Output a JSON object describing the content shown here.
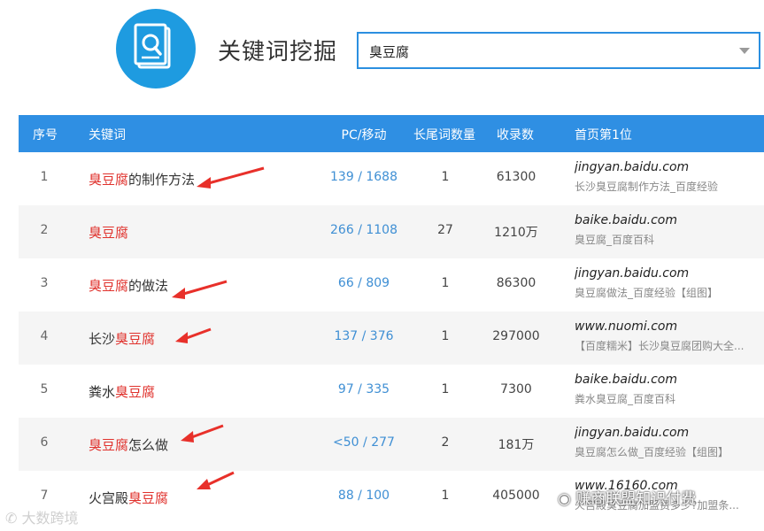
{
  "header": {
    "title": "关键词挖掘",
    "search_value": "臭豆腐"
  },
  "table": {
    "columns": [
      "序号",
      "关键词",
      "PC/移动",
      "长尾词数量",
      "收录数",
      "首页第1位"
    ],
    "rows": [
      {
        "idx": "1",
        "pre": "",
        "hl": "臭豆腐",
        "post": "的制作方法",
        "pc": "139 / 1688",
        "tail": "1",
        "rec": "61300",
        "domain": "jingyan.baidu.com",
        "desc": "长沙臭豆腐制作方法_百度经验"
      },
      {
        "idx": "2",
        "pre": "",
        "hl": "臭豆腐",
        "post": "",
        "pc": "266 / 1108",
        "tail": "27",
        "rec": "1210万",
        "domain": "baike.baidu.com",
        "desc": "臭豆腐_百度百科"
      },
      {
        "idx": "3",
        "pre": "",
        "hl": "臭豆腐",
        "post": "的做法",
        "pc": "66 / 809",
        "tail": "1",
        "rec": "86300",
        "domain": "jingyan.baidu.com",
        "desc": "臭豆腐做法_百度经验【组图】"
      },
      {
        "idx": "4",
        "pre": "长沙",
        "hl": "臭豆腐",
        "post": "",
        "pc": "137 / 376",
        "tail": "1",
        "rec": "297000",
        "domain": "www.nuomi.com",
        "desc": "【百度糯米】长沙臭豆腐团购大全..."
      },
      {
        "idx": "5",
        "pre": "粪水",
        "hl": "臭豆腐",
        "post": "",
        "pc": "97 / 335",
        "tail": "1",
        "rec": "7300",
        "domain": "baike.baidu.com",
        "desc": "粪水臭豆腐_百度百科"
      },
      {
        "idx": "6",
        "pre": "",
        "hl": "臭豆腐",
        "post": "怎么做",
        "pc": "<50 / 277",
        "tail": "2",
        "rec": "181万",
        "domain": "jingyan.baidu.com",
        "desc": "臭豆腐怎么做_百度经验【组图】"
      },
      {
        "idx": "7",
        "pre": "火宫殿",
        "hl": "臭豆腐",
        "post": "",
        "pc": "88 / 100",
        "tail": "1",
        "rec": "405000",
        "domain": "www.16160.com",
        "desc": "火宫殿臭豆腐加盟费多少?加盟条..."
      }
    ]
  },
  "watermarks": {
    "left": "大数跨境",
    "right": "赚商联盟知识付费"
  }
}
